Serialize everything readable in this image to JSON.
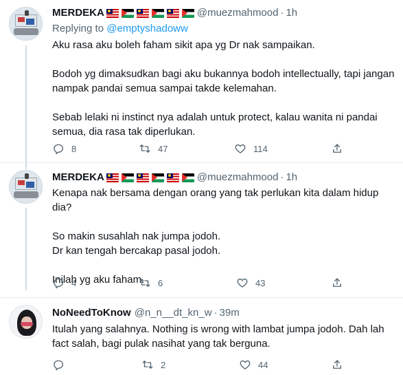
{
  "tweets": [
    {
      "name": "MERDEKA",
      "flags": [
        "malaysia-flag",
        "palestine-flag",
        "malaysia-flag",
        "palestine-flag",
        "malaysia-flag",
        "palestine-flag"
      ],
      "handle": "@muezmahmood",
      "dot": "·",
      "time": "1h",
      "replying_prefix": "Replying to",
      "replying_to": "@emptyshadoww",
      "lines": [
        "Aku rasa aku boleh faham sikit apa yg Dr nak sampaikan.",
        "",
        "Bodoh yg dimaksudkan bagi aku bukannya bodoh intellectually, tapi jangan",
        "nampak pandai semua sampai takde kelemahan.",
        "",
        "Sebab lelaki ni instinct nya adalah untuk protect, kalau wanita ni pandai",
        "semua, dia rasa tak diperlukan."
      ],
      "replies": "8",
      "retweets": "47",
      "likes": "114"
    },
    {
      "name": "MERDEKA",
      "flags": [
        "malaysia-flag",
        "palestine-flag",
        "malaysia-flag",
        "palestine-flag",
        "malaysia-flag",
        "palestine-flag"
      ],
      "handle": "@muezmahmood",
      "dot": "·",
      "time": "1h",
      "lines": [
        "Kenapa nak bersama dengan orang yang tak perlukan kita dalam hidup dia?",
        "",
        "So makin susahlah nak jumpa jodoh.",
        "Dr kan tengah bercakap pasal jodoh.",
        "",
        "Inilah yg aku faham."
      ],
      "replies": "4",
      "retweets": "6",
      "likes": "43"
    },
    {
      "name": "NoNeedToKnow",
      "handle": "@n_n__dt_kn_w",
      "dot": "·",
      "time": "39m",
      "lines": [
        "Itulah yang salahnya. Nothing is wrong with lambat jumpa jodoh. Dah lah",
        "fact salah, bagi pulak nasihat yang tak berguna."
      ],
      "replies": "",
      "retweets": "2",
      "likes": "44"
    }
  ],
  "colors": {
    "text": "#0f1419",
    "secondary": "#536471",
    "link": "#1d9bf0",
    "divider": "#e6ecf0"
  },
  "icons": {
    "reply": "reply-icon",
    "retweet": "retweet-icon",
    "like": "heart-icon",
    "share": "share-icon"
  }
}
